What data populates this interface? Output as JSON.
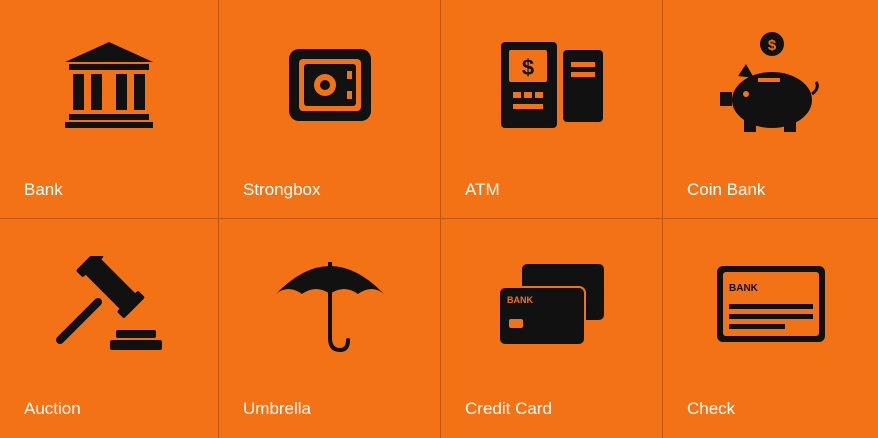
{
  "colors": {
    "background": "#f47216",
    "icon": "#111111",
    "label": "#ffffff",
    "divider": "#c4560c"
  },
  "tiles": [
    {
      "label": "Bank",
      "icon": "bank-building-icon"
    },
    {
      "label": "Strongbox",
      "icon": "safe-icon"
    },
    {
      "label": "ATM",
      "icon": "atm-icon",
      "screen_text": "$"
    },
    {
      "label": "Coin Bank",
      "icon": "piggy-bank-icon",
      "coin_text": "$"
    },
    {
      "label": "Auction",
      "icon": "gavel-icon"
    },
    {
      "label": "Umbrella",
      "icon": "umbrella-icon"
    },
    {
      "label": "Credit Card",
      "icon": "credit-card-icon",
      "card_text": "BANK"
    },
    {
      "label": "Check",
      "icon": "check-icon",
      "check_text": "BANK"
    }
  ]
}
